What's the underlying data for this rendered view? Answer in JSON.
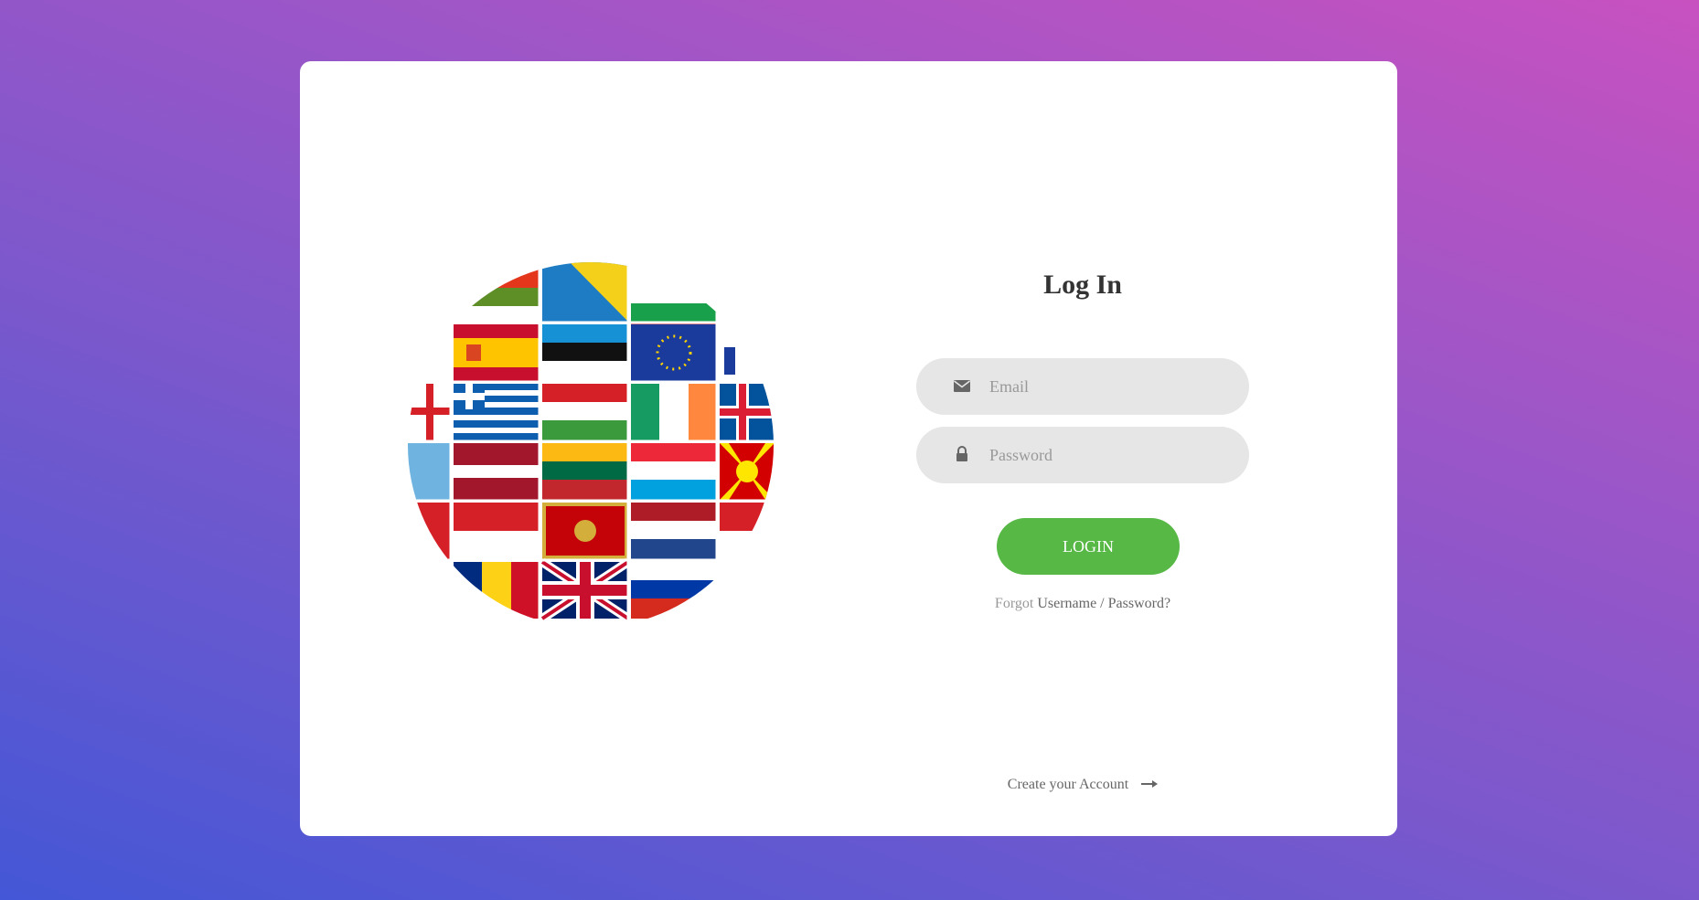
{
  "login": {
    "title": "Log In",
    "email_placeholder": "Email",
    "password_placeholder": "Password",
    "button_label": "LOGIN",
    "forgot_prefix": "Forgot",
    "forgot_username": "Username",
    "forgot_separator": "/",
    "forgot_password": "Password?",
    "create_account": "Create your Account"
  },
  "icons": {
    "email": "envelope-icon",
    "password": "lock-icon",
    "create_account": "arrow-right-icon"
  },
  "colors": {
    "button": "#57b846",
    "input_bg": "#e6e6e6",
    "gradient_start": "#4457d6",
    "gradient_end": "#c851c0"
  }
}
